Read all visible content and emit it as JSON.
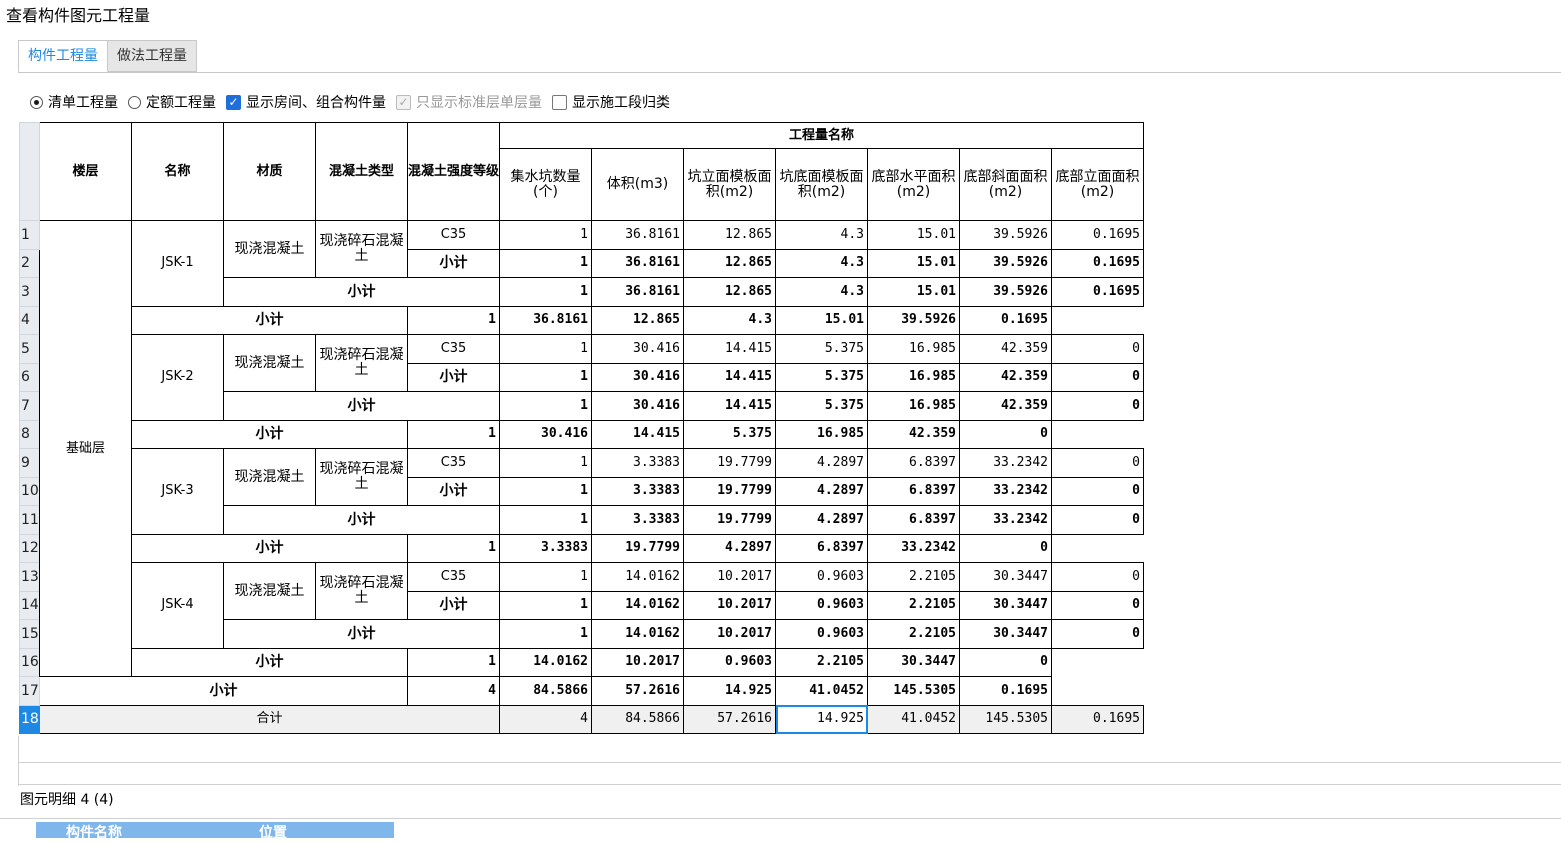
{
  "window": {
    "title": "查看构件图元工程量"
  },
  "tabs": [
    {
      "label": "构件工程量",
      "active": true
    },
    {
      "label": "做法工程量",
      "active": false
    }
  ],
  "options": {
    "radio_bill": {
      "label": "清单工程量",
      "checked": true
    },
    "radio_quota": {
      "label": "定额工程量",
      "checked": false
    },
    "cb_show_room": {
      "label": "显示房间、组合构件量",
      "checked": true
    },
    "cb_std_floor": {
      "label": "只显示标准层单层量",
      "checked": true,
      "disabled": true
    },
    "cb_stage": {
      "label": "显示施工段归类",
      "checked": false
    }
  },
  "table": {
    "headers": {
      "floor": "楼层",
      "name": "名称",
      "material": "材质",
      "concrete_type": "混凝土类型",
      "concrete_grade": "混凝土强度等级",
      "group": "工程量名称",
      "cols": [
        "集水坑数量(个)",
        "体积(m3)",
        "坑立面模板面积(m2)",
        "坑底面模板面积(m2)",
        "底部水平面积(m2)",
        "底部斜面面积(m2)",
        "底部立面面积(m2)"
      ]
    },
    "row_numbers": [
      "1",
      "2",
      "3",
      "4",
      "5",
      "6",
      "7",
      "8",
      "9",
      "10",
      "11",
      "12",
      "13",
      "14",
      "15",
      "16",
      "17",
      "18"
    ],
    "floor": "基础层",
    "material": "现浇混凝土",
    "concrete_type": "现浇碎石混凝土",
    "subtotal": "小计",
    "total": "合计",
    "groups": [
      {
        "name": "JSK-1",
        "grade": "C35",
        "values": [
          "1",
          "36.8161",
          "12.865",
          "4.3",
          "15.01",
          "39.5926",
          "0.1695"
        ]
      },
      {
        "name": "JSK-2",
        "grade": "C35",
        "values": [
          "1",
          "30.416",
          "14.415",
          "5.375",
          "16.985",
          "42.359",
          "0"
        ]
      },
      {
        "name": "JSK-3",
        "grade": "C35",
        "values": [
          "1",
          "3.3383",
          "19.7799",
          "4.2897",
          "6.8397",
          "33.2342",
          "0"
        ]
      },
      {
        "name": "JSK-4",
        "grade": "C35",
        "values": [
          "1",
          "14.0162",
          "10.2017",
          "0.9603",
          "2.2105",
          "30.3447",
          "0"
        ]
      }
    ],
    "floor_subtotal": [
      "4",
      "84.5866",
      "57.2616",
      "14.925",
      "41.0452",
      "145.5305",
      "0.1695"
    ],
    "grand_total": [
      "4",
      "84.5866",
      "57.2616",
      "14.925",
      "41.0452",
      "145.5305",
      "0.1695"
    ]
  },
  "detail": {
    "label": "图元明细",
    "count": "4 (4)",
    "columns": [
      "构件名称",
      "位置"
    ]
  }
}
